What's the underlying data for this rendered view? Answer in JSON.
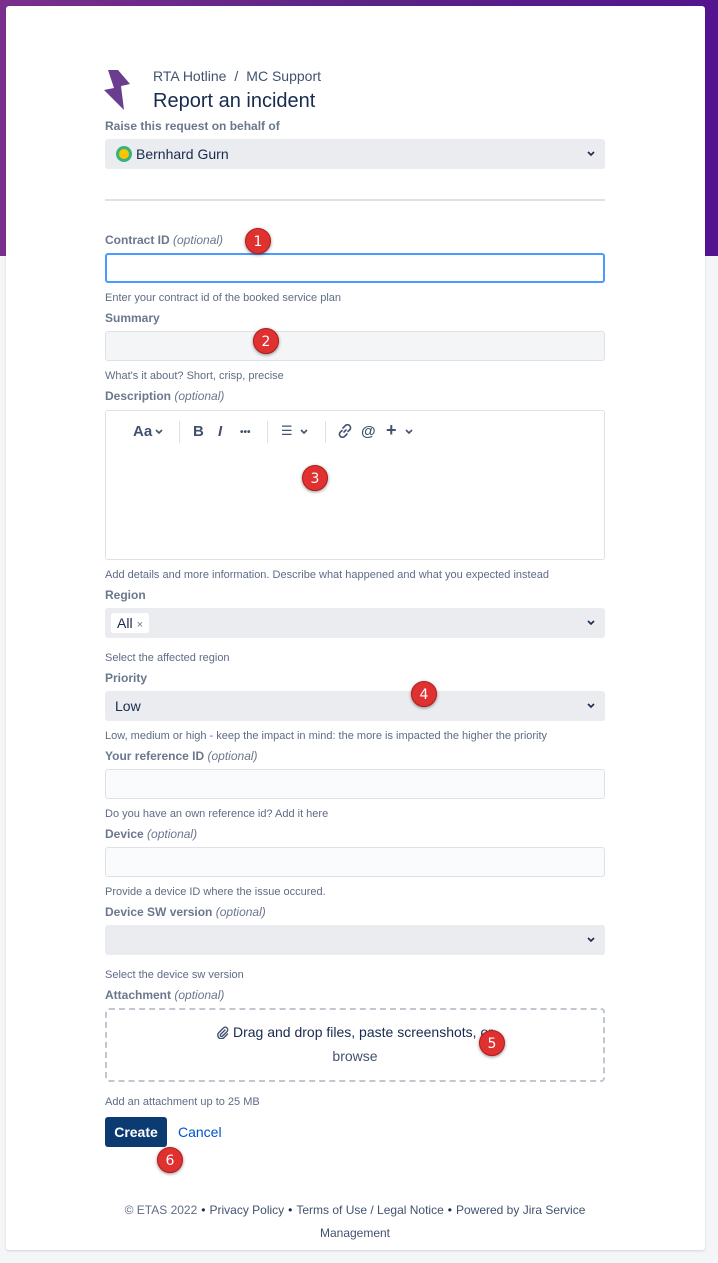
{
  "breadcrumb": {
    "first": "RTA Hotline",
    "separator": "/",
    "second": "MC Support"
  },
  "page_title": "Report an incident",
  "raise_on_behalf": {
    "label": "Raise this request on behalf of",
    "value": "Bernhard Gurn"
  },
  "contract_id": {
    "label": "Contract ID",
    "optional": "(optional)",
    "value": "",
    "help": "Enter your contract id of the booked service plan"
  },
  "summary": {
    "label": "Summary",
    "value": "",
    "help": "What's it about? Short, crisp, precise"
  },
  "description": {
    "label": "Description",
    "optional": "(optional)",
    "toolbar": {
      "text_style": "Aa",
      "bold": "B",
      "italic": "I",
      "more": "•••",
      "list": "☰",
      "link": "🔗",
      "mention": "@",
      "insert": "+"
    },
    "help": "Add details and more information. Describe what happened and what you expected instead"
  },
  "region": {
    "label": "Region",
    "chip": "All",
    "chip_remove": "×",
    "help": "Select the affected region"
  },
  "priority": {
    "label": "Priority",
    "value": "Low",
    "help": "Low, medium or high - keep the impact in mind: the more is impacted the higher the priority"
  },
  "reference_id": {
    "label": "Your reference ID",
    "optional": "(optional)",
    "value": "",
    "help": "Do you have an own reference id? Add it here"
  },
  "device": {
    "label": "Device",
    "optional": "(optional)",
    "value": "",
    "help": "Provide a device ID where the issue occured."
  },
  "device_sw": {
    "label": "Device SW version",
    "optional": "(optional)",
    "value": "",
    "help": "Select the device sw version"
  },
  "attachment": {
    "label": "Attachment",
    "optional": "(optional)",
    "drop_text": "Drag and drop files, paste screenshots, or",
    "browse": "browse",
    "help": "Add an attachment up to 25 MB"
  },
  "actions": {
    "create": "Create",
    "cancel": "Cancel"
  },
  "markers": [
    "1",
    "2",
    "3",
    "4",
    "5",
    "6"
  ],
  "footer": {
    "copyright": "© ETAS 2022",
    "dot": "•",
    "privacy": "Privacy Policy",
    "terms": "Terms of Use / Legal Notice",
    "powered_line1": "Powered by Jira Service",
    "powered_line2": "Management"
  },
  "colors": {
    "banner": "#5b2386",
    "primary_button": "#0c3b72",
    "focus_border": "#4c9aff",
    "marker": "#e03131",
    "link": "#0052cc"
  }
}
